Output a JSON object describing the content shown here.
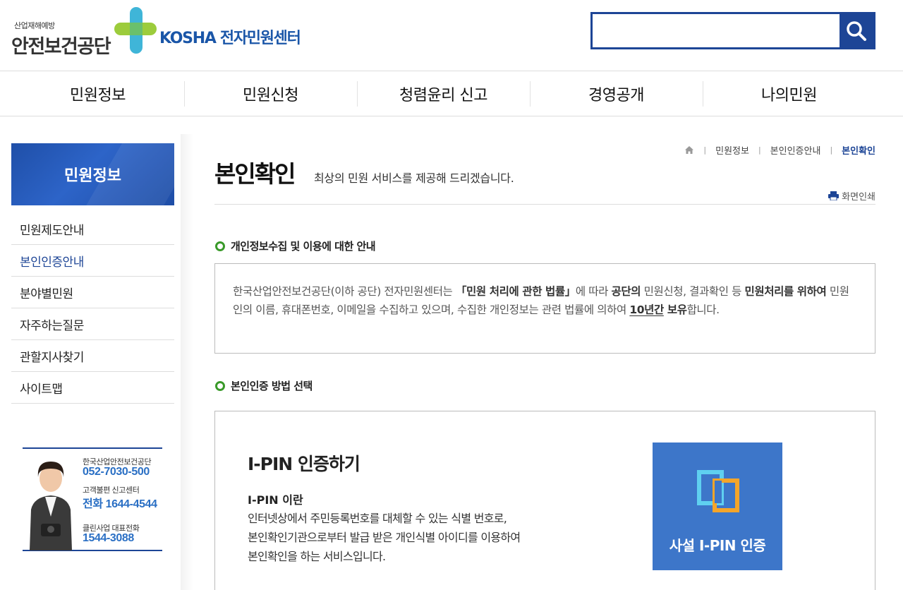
{
  "header": {
    "logo_small": "산업재해예방",
    "logo_org": "안전보건공단",
    "logo_center": "KOSHA 전자민원센터",
    "search_placeholder": "",
    "search_value": ""
  },
  "gnb": {
    "items": [
      {
        "label": "민원정보"
      },
      {
        "label": "민원신청"
      },
      {
        "label": "청렴윤리 신고"
      },
      {
        "label": "경영공개"
      },
      {
        "label": "나의민원"
      }
    ]
  },
  "lnb": {
    "title": "민원정보",
    "items": [
      {
        "label": "민원제도안내"
      },
      {
        "label": "본인인증안내"
      },
      {
        "label": "분야별민원"
      },
      {
        "label": "자주하는질문"
      },
      {
        "label": "관할지사찾기"
      },
      {
        "label": "사이트맵"
      }
    ],
    "active_index": 1
  },
  "banner": {
    "line1": "한국산업안전보건공단",
    "line2": "052-7030-500",
    "line3": "고객불편 신고센터",
    "line4": "전화 1644-4544",
    "line5": "클린사업 대표전화",
    "line6": "1544-3088"
  },
  "breadcrumb": {
    "items": [
      "민원정보",
      "본인인증안내"
    ],
    "current": "본인확인"
  },
  "page": {
    "title": "본인확인",
    "subtitle": "최상의 민원 서비스를 제공해 드리겠습니다.",
    "print_label": "화면인쇄"
  },
  "privacy": {
    "heading": "개인정보수집 및 이용에 대한 안내",
    "t1": "한국산업안전보건공단(이하 공단) 전자민원센터는 ",
    "b1": "「민원 처리에 관한 법률」",
    "t2": "에 따라 ",
    "b2": "공단의",
    "t3": " 민원신청, 결과확인 등 ",
    "b3": "민원처리를 위하여",
    "t4": " 민원인의 이름, 휴대폰번호, 이메일을 수집하고 있으며, 수집한 개인정보는 관련 법률에 의하여 ",
    "u1": "10년간",
    "b4": " 보유",
    "t5": "합니다."
  },
  "method": {
    "heading": "본인인증 방법 선택",
    "ipin_title": "I-PIN 인증하기",
    "ipin_sub": "I-PIN 이란",
    "ipin_desc1": "인터넷상에서 주민등록번호를 대체할 수 있는 식별 번호로,",
    "ipin_desc2": "본인확인기관으로부터 발급 받은 개인식별 아이디를 이용하여",
    "ipin_desc3": "본인확인을 하는 서비스입니다.",
    "ipin_button": "사설 I-PIN 인증"
  },
  "colors": {
    "primary": "#1d4596",
    "ipin_button": "#3d76c9",
    "section_dot": "#3a9a2a"
  }
}
